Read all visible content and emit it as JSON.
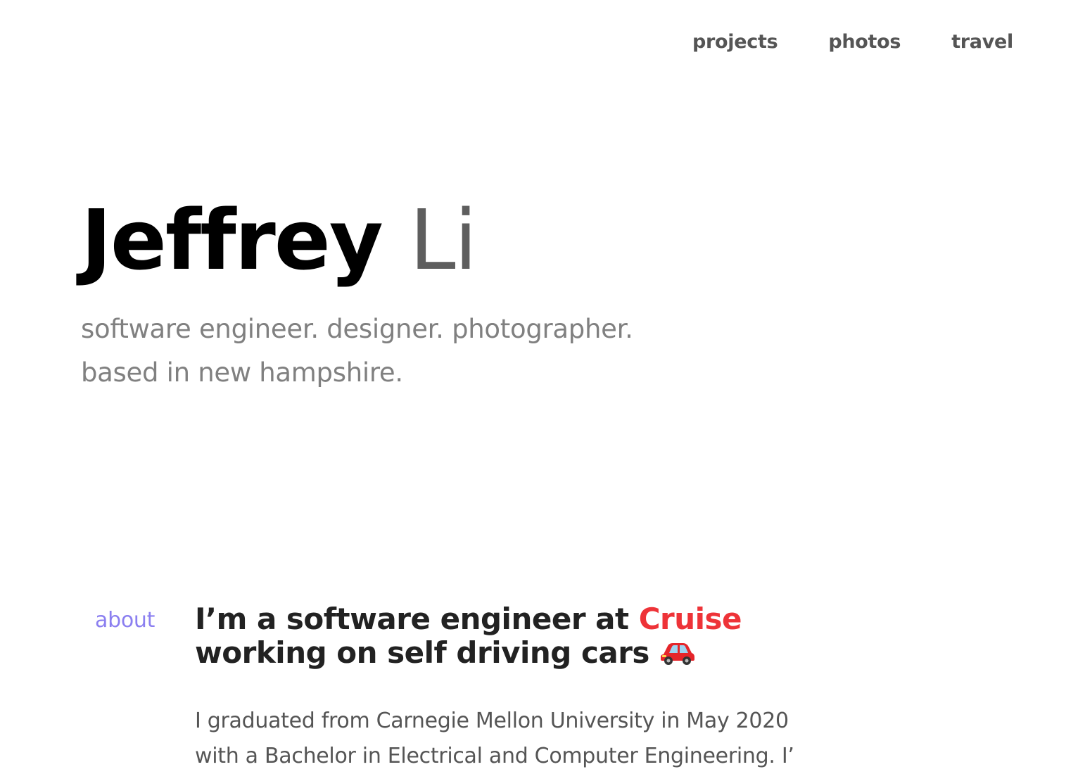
{
  "nav": {
    "items": [
      {
        "label": "projects"
      },
      {
        "label": "photos"
      },
      {
        "label": "travel"
      }
    ]
  },
  "hero": {
    "first_name": "Jeffrey",
    "last_name": "Li",
    "tagline_line1": "software engineer. designer. photographer.",
    "tagline_line2": "based in new hampshire."
  },
  "about": {
    "label": "about",
    "heading_prefix": "I’m a software engineer at",
    "company": "Cruise",
    "heading_line2": "working on self driving cars",
    "car_icon": "red-car-emoji",
    "body_line1": "I graduated from Carnegie Mellon University in May 2020",
    "body_line2": "with a Bachelor in Electrical and Computer Engineering. I’"
  },
  "colors": {
    "accent_about": "#8b7ff0",
    "accent_cruise": "#ee3338",
    "car_red": "#e5252a"
  }
}
